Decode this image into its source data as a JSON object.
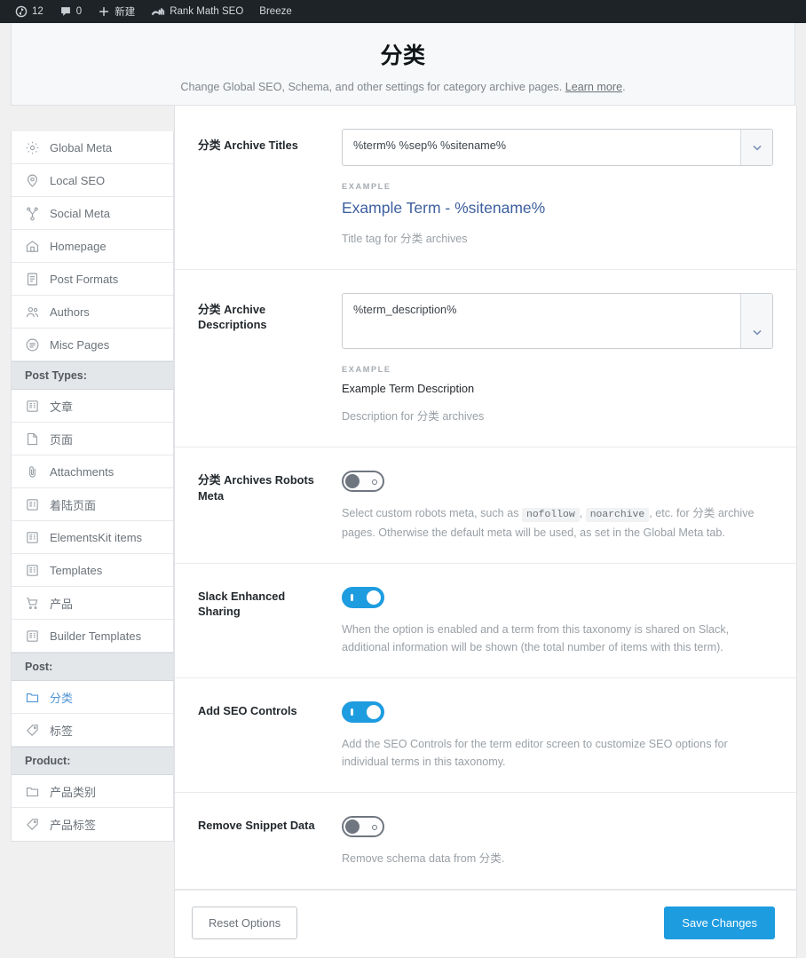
{
  "adminbar": {
    "items": [
      {
        "icon": "wordpress-updates-icon",
        "label": "12",
        "name": "updates"
      },
      {
        "icon": "comment-bubble-icon",
        "label": "0",
        "name": "comments"
      },
      {
        "icon": "plus-icon",
        "label": "新建",
        "name": "new-content"
      },
      {
        "icon": "rank-math-logo-icon",
        "label": "Rank Math SEO",
        "name": "rank-math"
      },
      {
        "icon": "",
        "label": "Breeze",
        "name": "breeze"
      }
    ]
  },
  "header": {
    "title": "分类",
    "description": "Change Global SEO, Schema, and other settings for category archive pages.",
    "learn_more": "Learn more",
    "description_end": "."
  },
  "sidebar": {
    "items": [
      {
        "type": "item",
        "icon": "gear-icon",
        "label": "Global Meta",
        "active": false
      },
      {
        "type": "item",
        "icon": "map-pin-icon",
        "label": "Local SEO",
        "active": false
      },
      {
        "type": "item",
        "icon": "share-network-icon",
        "label": "Social Meta",
        "active": false
      },
      {
        "type": "item",
        "icon": "home-icon",
        "label": "Homepage",
        "active": false
      },
      {
        "type": "item",
        "icon": "document-icon",
        "label": "Post Formats",
        "active": false
      },
      {
        "type": "item",
        "icon": "users-icon",
        "label": "Authors",
        "active": false
      },
      {
        "type": "item",
        "icon": "list-circle-icon",
        "label": "Misc Pages",
        "active": false
      },
      {
        "type": "header",
        "label": "Post Types:"
      },
      {
        "type": "item",
        "icon": "post-icon",
        "label": "文章",
        "active": false
      },
      {
        "type": "item",
        "icon": "page-icon",
        "label": "页面",
        "active": false
      },
      {
        "type": "item",
        "icon": "paperclip-icon",
        "label": "Attachments",
        "active": false
      },
      {
        "type": "item",
        "icon": "post-icon",
        "label": "着陆页面",
        "active": false
      },
      {
        "type": "item",
        "icon": "post-icon",
        "label": "ElementsKit items",
        "active": false
      },
      {
        "type": "item",
        "icon": "post-icon",
        "label": "Templates",
        "active": false
      },
      {
        "type": "item",
        "icon": "cart-icon",
        "label": "产品",
        "active": false
      },
      {
        "type": "item",
        "icon": "post-icon",
        "label": "Builder Templates",
        "active": false
      },
      {
        "type": "header",
        "label": "Post:"
      },
      {
        "type": "item",
        "icon": "folder-icon",
        "label": "分类",
        "active": true
      },
      {
        "type": "item",
        "icon": "tag-icon",
        "label": "标签",
        "active": false
      },
      {
        "type": "header",
        "label": "Product:"
      },
      {
        "type": "item",
        "icon": "folder-icon",
        "label": "产品类别",
        "active": false
      },
      {
        "type": "item",
        "icon": "tag-icon",
        "label": "产品标签",
        "active": false
      }
    ]
  },
  "fields": {
    "archive_titles": {
      "label": "分类 Archive Titles",
      "value": "%term% %sep% %sitename%",
      "example_label": "EXAMPLE",
      "example_value": "Example Term - %sitename%",
      "help": "Title tag for 分类 archives",
      "caret_icon": "chevron-down-icon"
    },
    "archive_descriptions": {
      "label": "分类 Archive Descriptions",
      "value": "%term_description%",
      "example_label": "EXAMPLE",
      "example_value": "Example Term Description",
      "help": "Description for 分类 archives",
      "caret_icon": "chevron-down-icon"
    },
    "robots_meta": {
      "label": "分类 Archives Robots Meta",
      "toggle": "off",
      "help_part1": "Select custom robots meta, such as ",
      "help_code1": "nofollow",
      "help_part2": ", ",
      "help_code2": "noarchive",
      "help_part3": ", etc. for 分类 archive pages. Otherwise the default meta will be used, as set in the Global Meta tab."
    },
    "slack_sharing": {
      "label": "Slack Enhanced Sharing",
      "toggle": "on",
      "help": "When the option is enabled and a term from this taxonomy is shared on Slack, additional information will be shown (the total number of items with this term)."
    },
    "seo_controls": {
      "label": "Add SEO Controls",
      "toggle": "on",
      "help": "Add the SEO Controls for the term editor screen to customize SEO options for individual terms in this taxonomy."
    },
    "remove_snippet": {
      "label": "Remove Snippet Data",
      "toggle": "off",
      "help": "Remove schema data from 分类."
    }
  },
  "footer": {
    "reset_label": "Reset Options",
    "save_label": "Save Changes"
  },
  "colors": {
    "accent_blue": "#1e9ce0",
    "link_blue": "#3d5f9e",
    "active_item": "#4f94d4",
    "adminbar_bg": "#1d2327",
    "page_bg": "#f0f0f1"
  }
}
